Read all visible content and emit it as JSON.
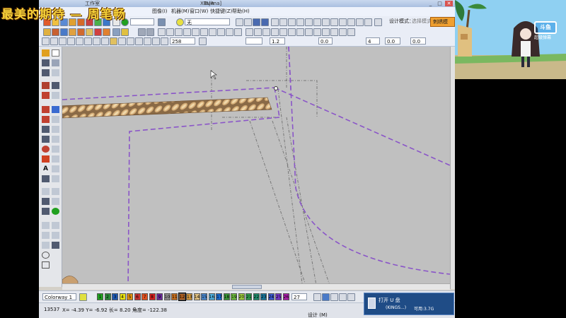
{
  "overlay": {
    "title": "最美的期待 — 周笔畅"
  },
  "app": {
    "window_title": "Tajima]",
    "title_fragments": [
      "工作室",
      "XBUA"
    ],
    "controls": {
      "minimize": "_",
      "maximize": "□",
      "close": "✕"
    }
  },
  "menu": [
    {
      "id": "image",
      "label": "图像(I)"
    },
    {
      "id": "machine",
      "label": "机器(M)"
    },
    {
      "id": "window",
      "label": "窗口(W)"
    },
    {
      "id": "shortcut",
      "label": "快捷键(Z)"
    },
    {
      "id": "help",
      "label": "帮助(H)"
    }
  ],
  "toolbar": {
    "stitch_combo": "无",
    "design_mode_label": "设计模式：",
    "select_mode_label": "选择模式",
    "mode_button_label": "刺绣模式",
    "zoom_value": "258",
    "spinners": [
      "1.2",
      "0.0",
      "4",
      "0.0",
      "0.0"
    ]
  },
  "palette": {
    "colorway": "Colorway 1",
    "swatches": [
      {
        "n": "1",
        "c": "#20a020"
      },
      {
        "n": "2",
        "c": "#2a8a3a"
      },
      {
        "n": "3",
        "c": "#1e5ab4"
      },
      {
        "n": "4",
        "c": "#e6e010"
      },
      {
        "n": "5",
        "c": "#e09010"
      },
      {
        "n": "6",
        "c": "#c83232"
      },
      {
        "n": "7",
        "c": "#e05020"
      },
      {
        "n": "8",
        "c": "#d42020"
      },
      {
        "n": "9",
        "c": "#6a2a9a"
      },
      {
        "n": "10",
        "c": "#909090"
      },
      {
        "n": "11",
        "c": "#c87020"
      },
      {
        "n": "12",
        "c": "#b06020"
      },
      {
        "n": "13",
        "c": "#d49a40"
      },
      {
        "n": "14",
        "c": "#e0c080"
      },
      {
        "n": "15",
        "c": "#4a8ad4"
      },
      {
        "n": "16",
        "c": "#50b0e0"
      },
      {
        "n": "17",
        "c": "#1a6ad0"
      },
      {
        "n": "18",
        "c": "#3a9a3a"
      },
      {
        "n": "19",
        "c": "#70c040"
      },
      {
        "n": "20",
        "c": "#a0d040"
      },
      {
        "n": "21",
        "c": "#30a050"
      },
      {
        "n": "22",
        "c": "#209070"
      },
      {
        "n": "23",
        "c": "#1a7aa0"
      },
      {
        "n": "24",
        "c": "#3a5ad0"
      },
      {
        "n": "25",
        "c": "#7a3ad0"
      },
      {
        "n": "26",
        "c": "#b020b0"
      }
    ],
    "count": "27"
  },
  "status": {
    "stitch_count": "13537",
    "coords": "X= -4.39 Y= -6.92 长= 8.20 角度= -122.38",
    "design": "设计 (M)"
  },
  "notification": {
    "title": "打开 U 盘",
    "drive": "(KINGS...)",
    "available": "可用:3.7G"
  },
  "webcam": {
    "sign_text": "斗鱼",
    "sub_text": "超级弹幕"
  },
  "colors": {
    "purple_dash": "#8a55c8",
    "rope_main": "#c89a62",
    "canvas": "#c0c0c0"
  }
}
